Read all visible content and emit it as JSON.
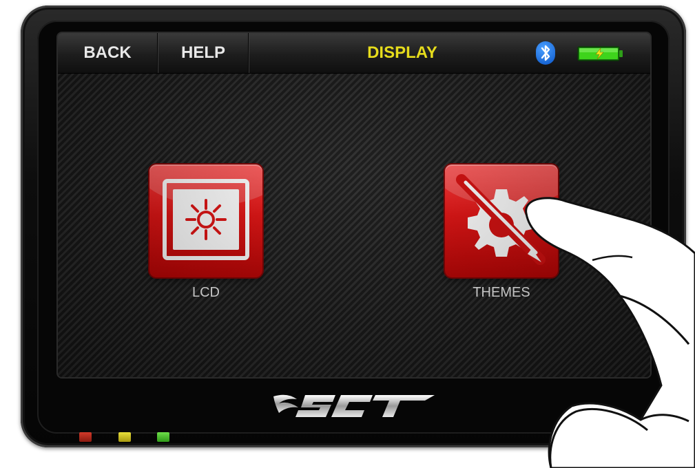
{
  "topbar": {
    "back_label": "BACK",
    "help_label": "HELP",
    "title": "DISPLAY",
    "bluetooth_icon": "bluetooth-icon",
    "battery_icon": "battery-charging-icon"
  },
  "apps": [
    {
      "label": "LCD",
      "icon": "brightness-sun-icon"
    },
    {
      "label": "THEMES",
      "icon": "gear-brush-icon"
    }
  ],
  "device": {
    "brand_logo": "SCT",
    "status_leds": [
      {
        "name": "red",
        "color": "#c8321f"
      },
      {
        "name": "yellow",
        "color": "#d8cf2a"
      },
      {
        "name": "green",
        "color": "#5fd43a"
      }
    ]
  },
  "colors": {
    "title_yellow": "#e6dc1c",
    "tile_red": "#e01010",
    "bluetooth_blue": "#0a6ae0",
    "battery_green": "#3ed41c"
  }
}
